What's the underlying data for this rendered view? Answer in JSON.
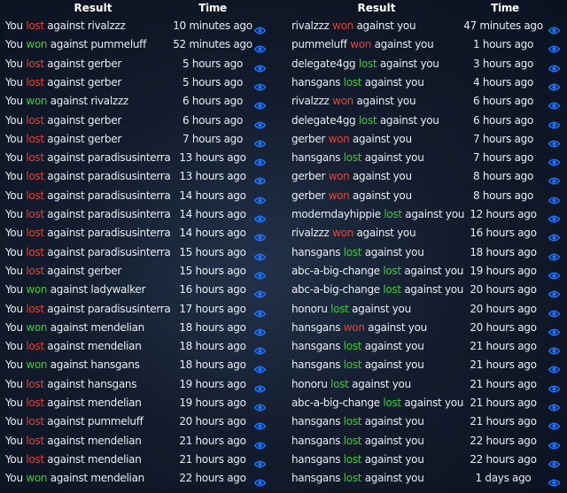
{
  "colors": {
    "bad": "#e0443c",
    "good": "#3ccc3c",
    "eye": "#1a73ff"
  },
  "left": {
    "headers": {
      "result": "Result",
      "time": "Time"
    },
    "rows": [
      {
        "subject": "You",
        "outcome": "lost",
        "object": "against rivalzzz",
        "time": "10 minutes ago"
      },
      {
        "subject": "You",
        "outcome": "won",
        "object": "against pummeluff",
        "time": "52 minutes ago"
      },
      {
        "subject": "You",
        "outcome": "lost",
        "object": "against gerber",
        "time": "5 hours ago"
      },
      {
        "subject": "You",
        "outcome": "lost",
        "object": "against gerber",
        "time": "5 hours ago"
      },
      {
        "subject": "You",
        "outcome": "won",
        "object": "against rivalzzz",
        "time": "6 hours ago"
      },
      {
        "subject": "You",
        "outcome": "lost",
        "object": "against gerber",
        "time": "6 hours ago"
      },
      {
        "subject": "You",
        "outcome": "lost",
        "object": "against gerber",
        "time": "7 hours ago"
      },
      {
        "subject": "You",
        "outcome": "lost",
        "object": "against paradisusinterra",
        "time": "13 hours ago"
      },
      {
        "subject": "You",
        "outcome": "lost",
        "object": "against paradisusinterra",
        "time": "13 hours ago"
      },
      {
        "subject": "You",
        "outcome": "lost",
        "object": "against paradisusinterra",
        "time": "14 hours ago"
      },
      {
        "subject": "You",
        "outcome": "lost",
        "object": "against paradisusinterra",
        "time": "14 hours ago"
      },
      {
        "subject": "You",
        "outcome": "lost",
        "object": "against paradisusinterra",
        "time": "14 hours ago"
      },
      {
        "subject": "You",
        "outcome": "lost",
        "object": "against paradisusinterra",
        "time": "15 hours ago"
      },
      {
        "subject": "You",
        "outcome": "lost",
        "object": "against gerber",
        "time": "15 hours ago"
      },
      {
        "subject": "You",
        "outcome": "won",
        "object": "against ladywalker",
        "time": "16 hours ago"
      },
      {
        "subject": "You",
        "outcome": "lost",
        "object": "against paradisusinterra",
        "time": "17 hours ago"
      },
      {
        "subject": "You",
        "outcome": "won",
        "object": "against mendelian",
        "time": "18 hours ago"
      },
      {
        "subject": "You",
        "outcome": "lost",
        "object": "against mendelian",
        "time": "18 hours ago"
      },
      {
        "subject": "You",
        "outcome": "won",
        "object": "against hansgans",
        "time": "18 hours ago"
      },
      {
        "subject": "You",
        "outcome": "lost",
        "object": "against hansgans",
        "time": "19 hours ago"
      },
      {
        "subject": "You",
        "outcome": "lost",
        "object": "against mendelian",
        "time": "19 hours ago"
      },
      {
        "subject": "You",
        "outcome": "lost",
        "object": "against pummeluff",
        "time": "20 hours ago"
      },
      {
        "subject": "You",
        "outcome": "lost",
        "object": "against mendelian",
        "time": "21 hours ago"
      },
      {
        "subject": "You",
        "outcome": "lost",
        "object": "against mendelian",
        "time": "21 hours ago"
      },
      {
        "subject": "You",
        "outcome": "won",
        "object": "against mendelian",
        "time": "22 hours ago"
      }
    ]
  },
  "right": {
    "headers": {
      "result": "Result",
      "time": "Time"
    },
    "rows": [
      {
        "subject": "rivalzzz",
        "outcome": "won",
        "object": "against you",
        "time": "47 minutes ago"
      },
      {
        "subject": "pummeluff",
        "outcome": "won",
        "object": "against you",
        "time": "1 hours ago"
      },
      {
        "subject": "delegate4gg",
        "outcome": "lost",
        "object": "against you",
        "time": "3 hours ago"
      },
      {
        "subject": "hansgans",
        "outcome": "lost",
        "object": "against you",
        "time": "4 hours ago"
      },
      {
        "subject": "rivalzzz",
        "outcome": "won",
        "object": "against you",
        "time": "6 hours ago"
      },
      {
        "subject": "delegate4gg",
        "outcome": "lost",
        "object": "against you",
        "time": "6 hours ago"
      },
      {
        "subject": "gerber",
        "outcome": "won",
        "object": "against you",
        "time": "7 hours ago"
      },
      {
        "subject": "hansgans",
        "outcome": "lost",
        "object": "against you",
        "time": "7 hours ago"
      },
      {
        "subject": "gerber",
        "outcome": "won",
        "object": "against you",
        "time": "8 hours ago"
      },
      {
        "subject": "gerber",
        "outcome": "won",
        "object": "against you",
        "time": "8 hours ago"
      },
      {
        "subject": "moderndayhippie",
        "outcome": "lost",
        "object": "against you",
        "time": "12 hours ago"
      },
      {
        "subject": "rivalzzz",
        "outcome": "won",
        "object": "against you",
        "time": "16 hours ago"
      },
      {
        "subject": "hansgans",
        "outcome": "lost",
        "object": "against you",
        "time": "18 hours ago"
      },
      {
        "subject": "abc-a-big-change",
        "outcome": "lost",
        "object": "against you",
        "time": "19 hours ago"
      },
      {
        "subject": "abc-a-big-change",
        "outcome": "lost",
        "object": "against you",
        "time": "20 hours ago"
      },
      {
        "subject": "honoru",
        "outcome": "lost",
        "object": "against you",
        "time": "20 hours ago"
      },
      {
        "subject": "hansgans",
        "outcome": "won",
        "object": "against you",
        "time": "20 hours ago"
      },
      {
        "subject": "hansgans",
        "outcome": "lost",
        "object": "against you",
        "time": "21 hours ago"
      },
      {
        "subject": "hansgans",
        "outcome": "lost",
        "object": "against you",
        "time": "21 hours ago"
      },
      {
        "subject": "honoru",
        "outcome": "lost",
        "object": "against you",
        "time": "21 hours ago"
      },
      {
        "subject": "abc-a-big-change",
        "outcome": "lost",
        "object": "against you",
        "time": "21 hours ago"
      },
      {
        "subject": "hansgans",
        "outcome": "lost",
        "object": "against you",
        "time": "21 hours ago"
      },
      {
        "subject": "hansgans",
        "outcome": "lost",
        "object": "against you",
        "time": "22 hours ago"
      },
      {
        "subject": "hansgans",
        "outcome": "lost",
        "object": "against you",
        "time": "22 hours ago"
      },
      {
        "subject": "hansgans",
        "outcome": "lost",
        "object": "against you",
        "time": "1 days ago"
      }
    ]
  }
}
